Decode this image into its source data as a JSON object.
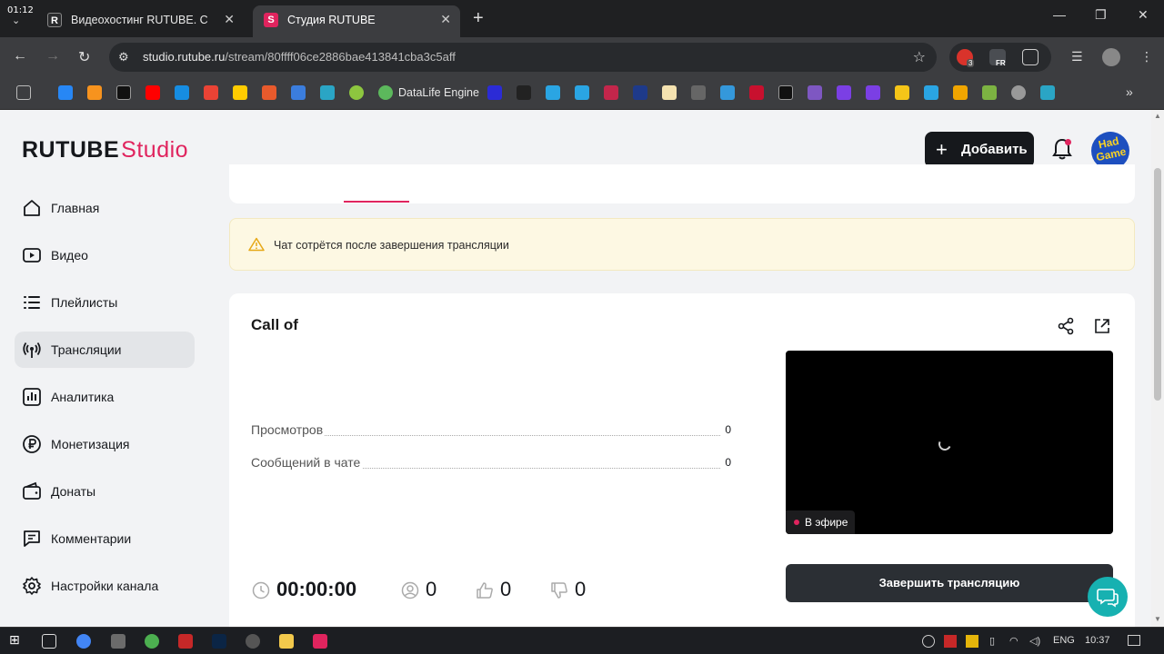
{
  "os": {
    "clock_corner": "01:12",
    "tray_lang": "ENG",
    "tray_time": "10:37"
  },
  "browser": {
    "tabs": [
      {
        "title": "Видеохостинг RUTUBE. Смотри",
        "favicon": "R"
      },
      {
        "title": "Студия RUTUBE",
        "favicon": "S"
      }
    ],
    "url_host": "studio.rutube.ru",
    "url_path": "/stream/80ffff06ce2886bae413841cba3c5aff",
    "bookmark_label": "DataLife Engine",
    "ext_badge_1": "3",
    "ext_badge_2": "FR"
  },
  "header": {
    "logo_main": "RUTUBE",
    "logo_studio": "Studio",
    "add_button": "Добавить",
    "avatar_text": "Had Game"
  },
  "sidebar": {
    "items": [
      {
        "label": "Главная",
        "icon": "home-icon"
      },
      {
        "label": "Видео",
        "icon": "video-icon"
      },
      {
        "label": "Плейлисты",
        "icon": "playlist-icon"
      },
      {
        "label": "Трансляции",
        "icon": "broadcast-icon",
        "active": true
      },
      {
        "label": "Аналитика",
        "icon": "analytics-icon"
      },
      {
        "label": "Монетизация",
        "icon": "ruble-icon"
      },
      {
        "label": "Донаты",
        "icon": "wallet-icon"
      },
      {
        "label": "Комментарии",
        "icon": "comment-icon"
      },
      {
        "label": "Настройки канала",
        "icon": "gear-icon"
      }
    ]
  },
  "warning": {
    "text": "Чат сотрётся после завершения трансляции"
  },
  "stream": {
    "title": "Call of",
    "stats": [
      {
        "label": "Просмотров",
        "value": "0"
      },
      {
        "label": "Сообщений в чате",
        "value": "0"
      }
    ],
    "live_badge": "В эфире",
    "duration": "00:00:00",
    "viewers": "0",
    "likes": "0",
    "dislikes": "0",
    "end_button": "Завершить трансляцию"
  },
  "colors": {
    "accent": "#e0245e",
    "dark": "#16181c",
    "warning_bg": "#fdf8e3",
    "chat_fab": "#17b1b1"
  }
}
